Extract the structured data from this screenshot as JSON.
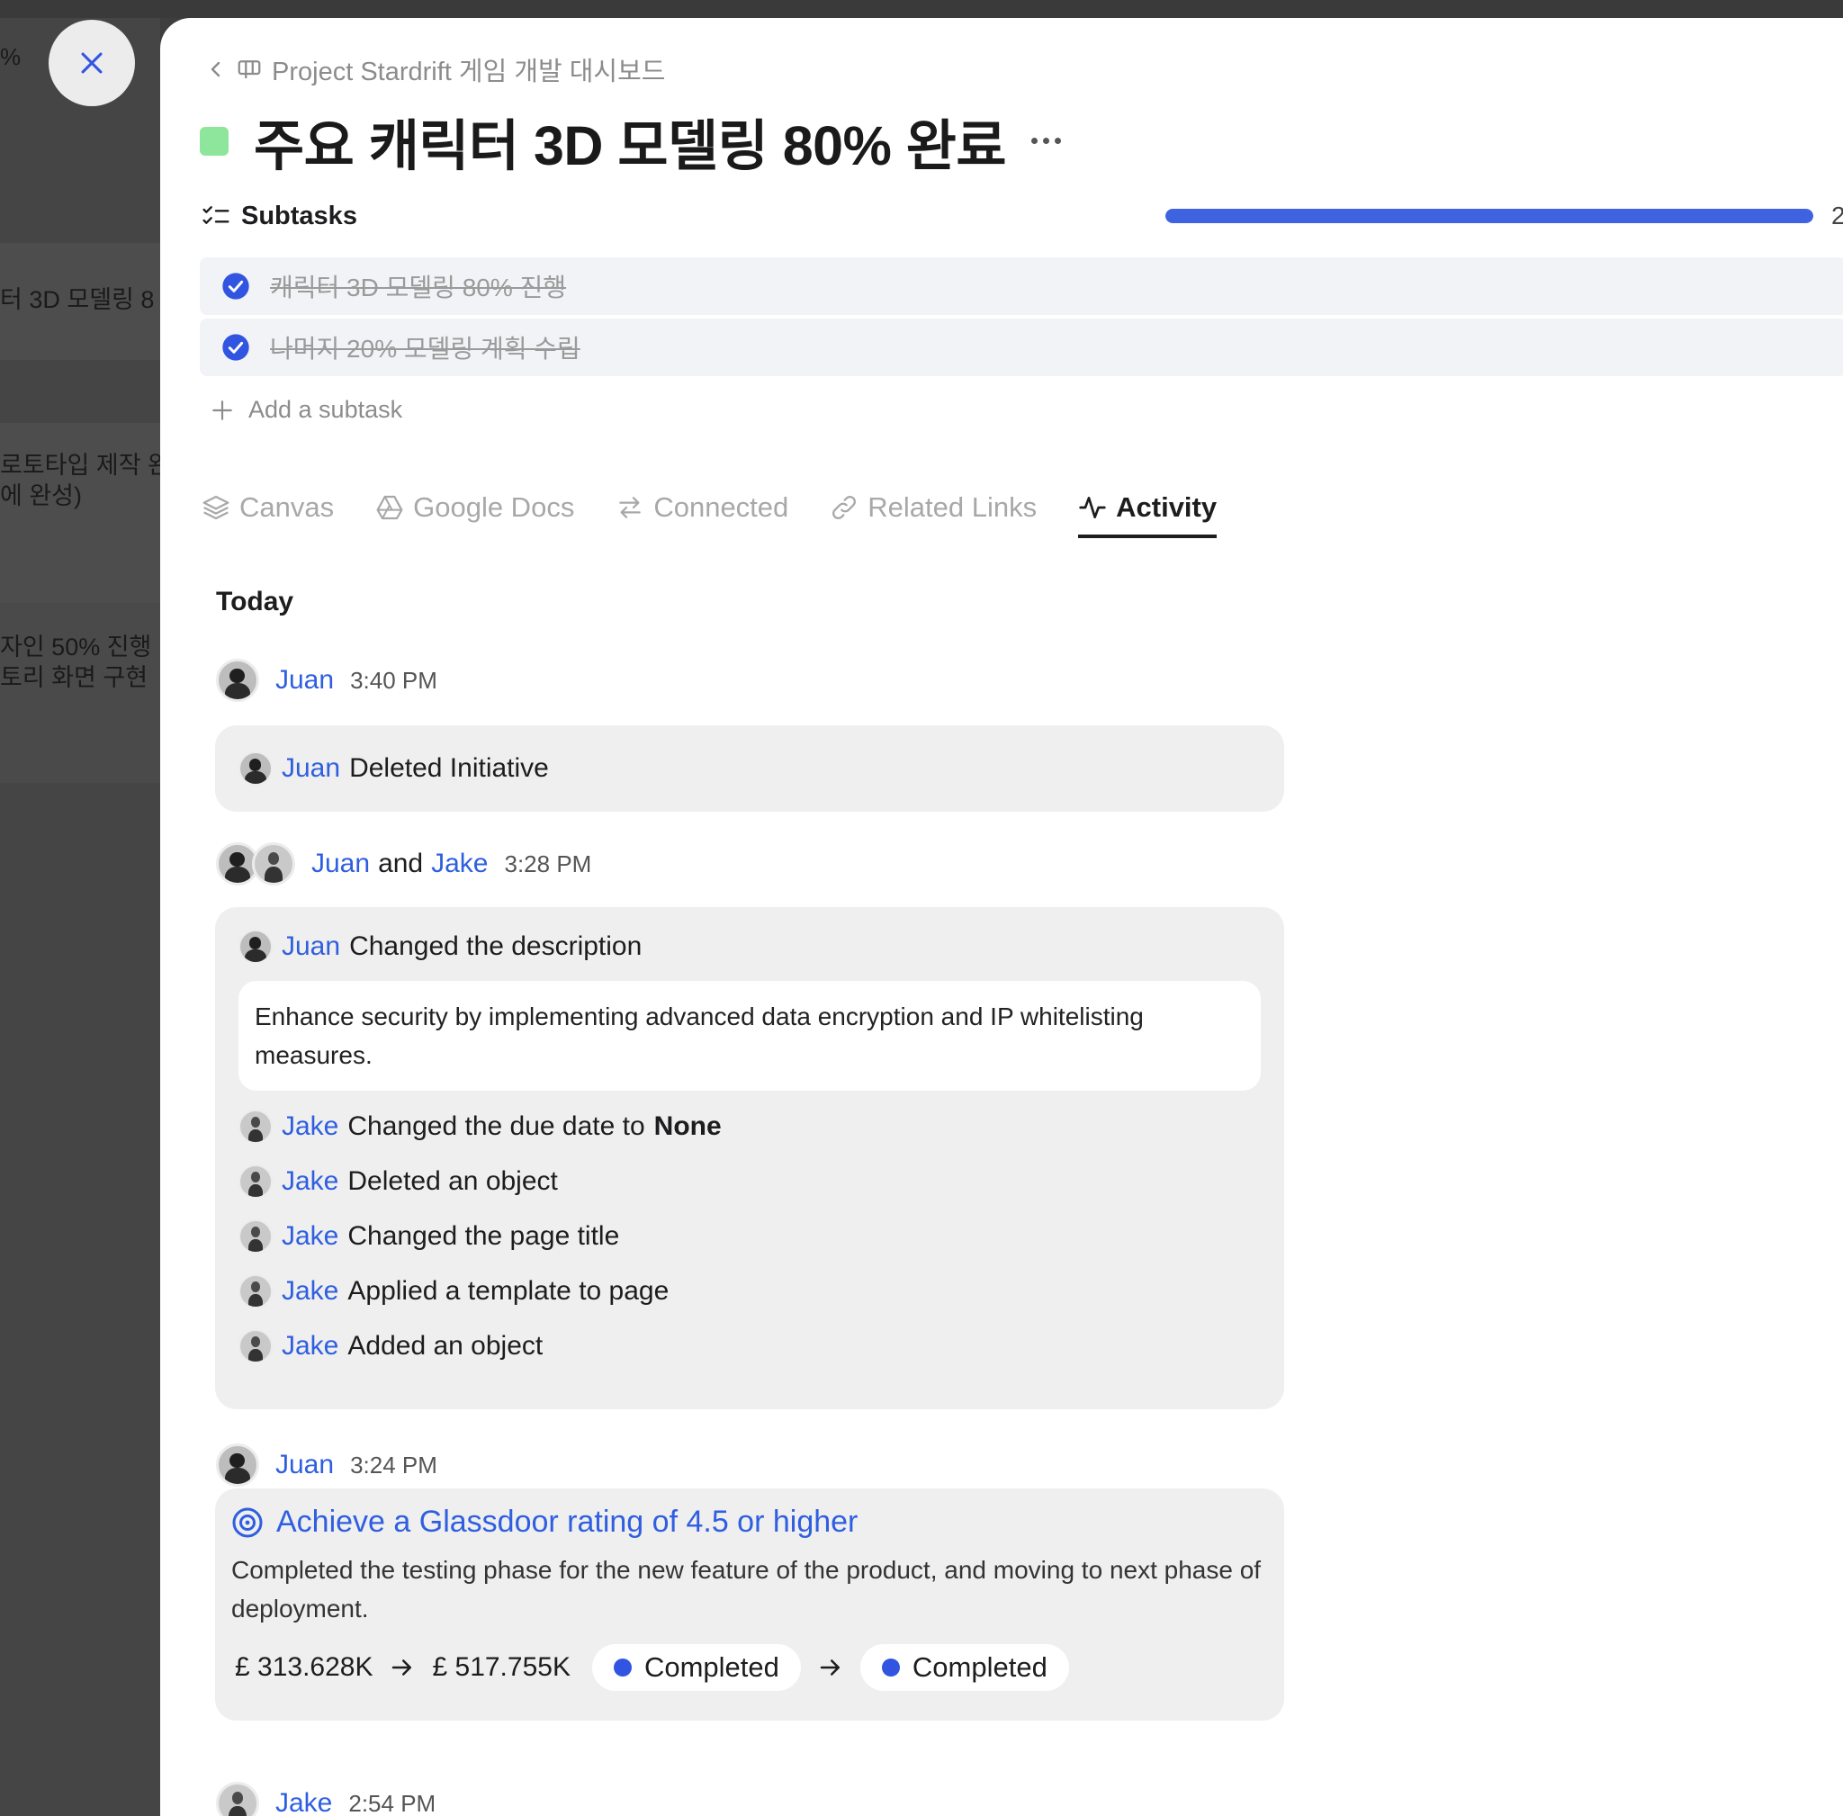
{
  "background": {
    "percent_text": "%",
    "card_texts": [
      "터 3D 모델링 8",
      "로토타입 제작 완",
      "에 완성)",
      "자인 50% 진행",
      "토리 화면 구현"
    ]
  },
  "breadcrumb": {
    "text": "Project Stardrift 게임 개발 대시보드"
  },
  "task": {
    "title": "주요 캐릭터 3D 모델링 80% 완료",
    "status_color": "#8de69b"
  },
  "subtasks": {
    "label": "Subtasks",
    "progress_fraction": 1.0,
    "count_text": "2",
    "items": [
      {
        "text": "캐릭터 3D 모델링 80% 진행",
        "done": true
      },
      {
        "text": "나머지 20% 모델링 계획 수립",
        "done": true
      }
    ],
    "add_label": "Add a subtask"
  },
  "tabs": [
    {
      "label": "Canvas",
      "icon": "layers-icon"
    },
    {
      "label": "Google Docs",
      "icon": "google-drive-icon"
    },
    {
      "label": "Connected",
      "icon": "swap-arrows-icon"
    },
    {
      "label": "Related Links",
      "icon": "link-icon"
    },
    {
      "label": "Activity",
      "icon": "activity-icon",
      "active": true
    }
  ],
  "activity": {
    "day_label": "Today",
    "groups": [
      {
        "actor": "Juan",
        "time": "3:40 PM",
        "entries": [
          {
            "actor": "Juan",
            "text": "Deleted Initiative"
          }
        ]
      },
      {
        "actor": "Juan",
        "joiner": "and",
        "actor2": "Jake",
        "time": "3:28 PM",
        "entries": [
          {
            "actor": "Juan",
            "text": "Changed the description",
            "quote": "Enhance security by implementing advanced data encryption and IP whitelisting measures."
          },
          {
            "actor": "Jake",
            "text": "Changed the due date to",
            "value": "None"
          },
          {
            "actor": "Jake",
            "text": "Deleted an object"
          },
          {
            "actor": "Jake",
            "text": "Changed the page title"
          },
          {
            "actor": "Jake",
            "text": "Applied a template to page"
          },
          {
            "actor": "Jake",
            "text": "Added an object"
          }
        ]
      },
      {
        "actor": "Juan",
        "time": "3:24 PM",
        "goal": {
          "title": "Achieve a Glassdoor rating of 4.5 or higher",
          "description": "Completed the testing phase for the new feature of the product, and moving to next phase of deployment.",
          "from_value": "£ 313.628K",
          "to_value": "£ 517.755K",
          "from_status": "Completed",
          "to_status": "Completed",
          "status_color": "#3155e0"
        }
      },
      {
        "actor": "Jake",
        "time": "2:54 PM"
      }
    ]
  }
}
